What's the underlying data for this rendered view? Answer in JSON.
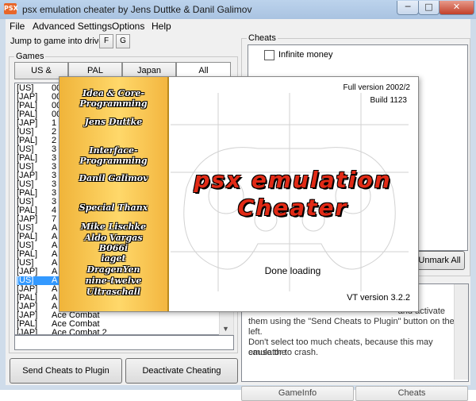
{
  "window": {
    "title": "psx emulation cheater by Jens Duttke & Danil Galimov",
    "icon": "psx-app-icon",
    "icon_text": "PSX"
  },
  "controls": {
    "minimize": "─",
    "maximize": "□",
    "close": "✕"
  },
  "menubar": {
    "items": [
      "File",
      "Advanced Settings",
      "Options",
      "Help"
    ]
  },
  "jump": {
    "label": "Jump to game into drive",
    "btn_f": "F",
    "btn_g": "G"
  },
  "games": {
    "legend": "Games",
    "tabs": [
      "US & Canada",
      "PAL",
      "Japan",
      "All"
    ],
    "active_tab": "All",
    "rows": [
      {
        "region": "[US]",
        "name": "00"
      },
      {
        "region": "[JAP]",
        "name": "00"
      },
      {
        "region": "[PAL]",
        "name": "00"
      },
      {
        "region": "[PAL]",
        "name": "00"
      },
      {
        "region": "[JAP]",
        "name": "1"
      },
      {
        "region": "[US]",
        "name": "2"
      },
      {
        "region": "[PAL]",
        "name": "2"
      },
      {
        "region": "[US]",
        "name": "3"
      },
      {
        "region": "[PAL]",
        "name": "3"
      },
      {
        "region": "[US]",
        "name": "3"
      },
      {
        "region": "[JAP]",
        "name": "3"
      },
      {
        "region": "[US]",
        "name": "3"
      },
      {
        "region": "[PAL]",
        "name": "3"
      },
      {
        "region": "[US]",
        "name": "3"
      },
      {
        "region": "[PAL]",
        "name": "4"
      },
      {
        "region": "[JAP]",
        "name": "7"
      },
      {
        "region": "[US]",
        "name": "A"
      },
      {
        "region": "[PAL]",
        "name": "A"
      },
      {
        "region": "[US]",
        "name": "A"
      },
      {
        "region": "[PAL]",
        "name": "A"
      },
      {
        "region": "[US]",
        "name": "A"
      },
      {
        "region": "[JAP]",
        "name": "A"
      },
      {
        "region": "[US]",
        "name": "A"
      },
      {
        "region": "[JAP]",
        "name": "A"
      },
      {
        "region": "[PAL]",
        "name": "A"
      },
      {
        "region": "[JAP]",
        "name": "A"
      },
      {
        "region": "[JAP]",
        "name": "Ace Combat"
      },
      {
        "region": "[PAL]",
        "name": "Ace Combat"
      },
      {
        "region": "[JAP]",
        "name": "Ace Combat 2"
      }
    ],
    "selected_index": 22
  },
  "buttons": {
    "send": "Send Cheats to Plugin",
    "deactivate": "Deactivate Cheating",
    "unmark": "Unmark All"
  },
  "cheats": {
    "legend": "Cheats",
    "items": [
      {
        "label": "Infinite money",
        "checked": false
      }
    ]
  },
  "info": {
    "line1": "and activate",
    "line2": "them using the \"Send Cheats to Plugin\" button on the left.",
    "line3": "Don't select too much cheats, because this may cause the",
    "line4": "emulator to crash."
  },
  "bottom_tabs": [
    "GameInfo",
    "Cheats"
  ],
  "splash": {
    "version": "Full version 2002/2",
    "build": "Build 1123",
    "credits": [
      "Idea & Core-",
      "Programming",
      "Jens Duttke",
      "Interface-",
      "Programming",
      "Danil Galimov",
      "Special Thanx",
      "Mike Lischke",
      "Aldo Vargas",
      "B066i",
      "iaget",
      "DragenYen",
      "nine-twelve",
      "Ultraschall"
    ],
    "logo_line1": "psx emulation",
    "logo_line2": "Cheater",
    "status": "Done loading",
    "vt_version": "VT version 3.2.2"
  },
  "colors": {
    "selection": "#3399ff",
    "logo_red": "#e12a16",
    "credits_gold": "#f0b43a"
  }
}
